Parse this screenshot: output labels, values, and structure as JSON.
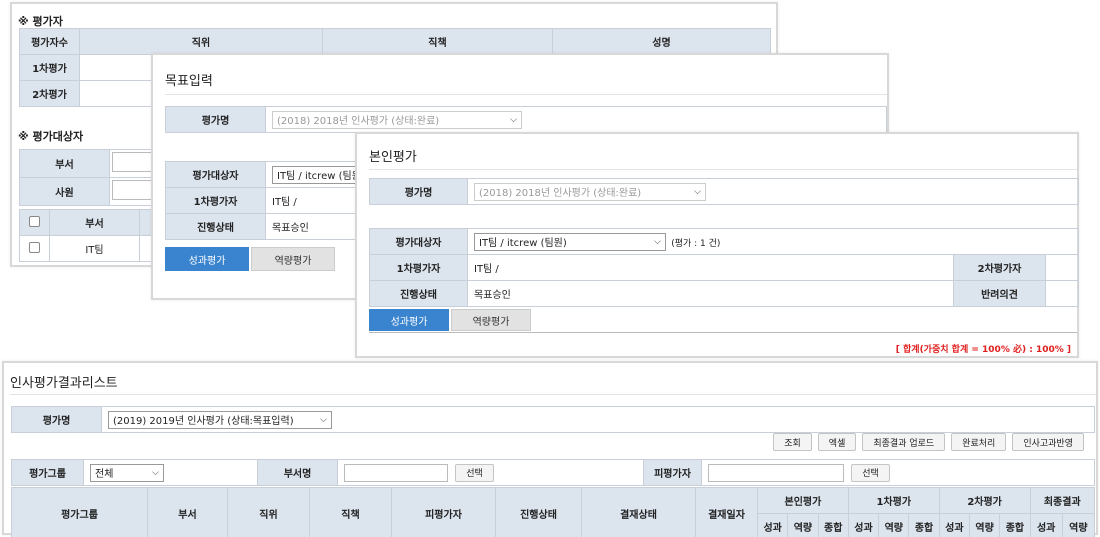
{
  "win_a": {
    "evaluator_title": "※ 평가자",
    "evaluator_headers": [
      "평가자수",
      "직위",
      "직책",
      "성명"
    ],
    "evaluator_rows": [
      "1차평가",
      "2차평가"
    ],
    "target_title": "※ 평가대상자",
    "dept_label": "부서",
    "employee_label": "사원",
    "list_dept_header": "부서",
    "list_row_dept": "IT팀"
  },
  "win_b": {
    "title": "목표입력",
    "eval_name_label": "평가명",
    "eval_name_value": "(2018) 2018년 인사평가 (상태:완료)",
    "target_label": "평가대상자",
    "target_value": "IT팀 / itcrew (팀원",
    "first_eval_label": "1차평가자",
    "first_eval_value": "IT팀 /",
    "status_label": "진행상태",
    "status_value": "목표승인",
    "tabs": [
      "성과평가",
      "역량평가"
    ]
  },
  "win_c": {
    "title": "본인평가",
    "eval_name_label": "평가명",
    "eval_name_value": "(2018) 2018년 인사평가 (상태:완료)",
    "target_label": "평가대상자",
    "target_value": "IT팀 / itcrew (팀원)",
    "count_text": "(평가 : 1 건)",
    "first_eval_label": "1차평가자",
    "first_eval_value": "IT팀 /",
    "second_eval_label": "2차평가자",
    "status_label": "진행상태",
    "status_value": "목표승인",
    "reject_label": "반려의견",
    "tabs": [
      "성과평가",
      "역량평가"
    ],
    "sum_text": "[ 합계(가중치 합계 = 100% 必) : 100% ]"
  },
  "win_d": {
    "title": "인사평가결과리스트",
    "eval_name_label": "평가명",
    "eval_name_value": "(2019) 2019년 인사평가 (상태:목표입력)",
    "buttons": [
      "조회",
      "엑셀",
      "최종결과 업로드",
      "완료처리",
      "인사고과반영"
    ],
    "group_label": "평가그룹",
    "group_value": "전체",
    "dept_label": "부서명",
    "select_btn": "선택",
    "evaluee_label": "피평가자",
    "columns": [
      "평가그룹",
      "부서",
      "직위",
      "직책",
      "피평가자",
      "진행상태",
      "결재상태",
      "결재일자"
    ],
    "groups": [
      "본인평가",
      "1차평가",
      "2차평가",
      "최종결과"
    ],
    "sub": [
      "성과",
      "역량",
      "종합"
    ],
    "final_sub": [
      "성과",
      "역량"
    ]
  },
  "colors": {
    "header_bg": "#dce4ee",
    "tab_active": "#3a84cf",
    "tab_inactive": "#e2e2e2",
    "sum_red": "#e02020"
  }
}
